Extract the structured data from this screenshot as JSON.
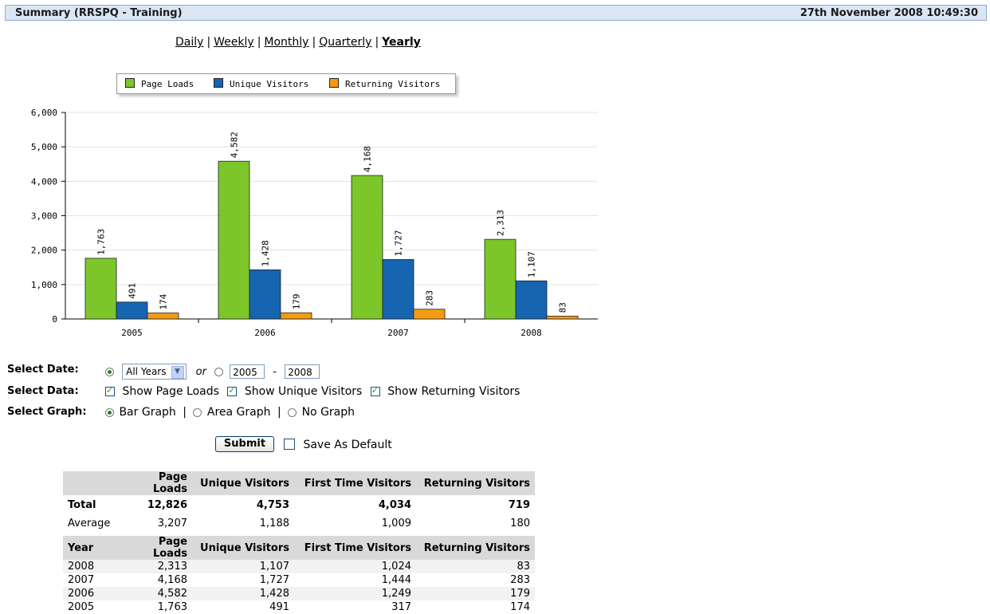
{
  "header": {
    "title": "Summary (RRSPQ - Training)",
    "datetime": "27th November 2008 10:49:30"
  },
  "period_nav": {
    "daily": "Daily",
    "weekly": "Weekly",
    "monthly": "Monthly",
    "quarterly": "Quarterly",
    "yearly": "Yearly",
    "separator": "|",
    "selected": "Yearly"
  },
  "legend": {
    "page_loads": "Page Loads",
    "unique_visitors": "Unique Visitors",
    "returning_visitors": "Returning Visitors"
  },
  "colors": {
    "page_loads": "#7cc62a",
    "unique_visitors": "#1565b0",
    "returning_visitors": "#f39c12",
    "header_bg": "#dbe6f5"
  },
  "chart_data": {
    "type": "bar",
    "categories": [
      "2005",
      "2006",
      "2007",
      "2008"
    ],
    "series": [
      {
        "name": "Page Loads",
        "values": [
          1763,
          4582,
          4168,
          2313
        ]
      },
      {
        "name": "Unique Visitors",
        "values": [
          491,
          1428,
          1727,
          1107
        ]
      },
      {
        "name": "Returning Visitors",
        "values": [
          174,
          179,
          283,
          83
        ]
      }
    ],
    "data_labels": [
      [
        "1,763",
        "4,582",
        "4,168",
        "2,313"
      ],
      [
        "491",
        "1,428",
        "1,727",
        "1,107"
      ],
      [
        "174",
        "179",
        "283",
        "83"
      ]
    ],
    "yticks": [
      "0",
      "1,000",
      "2,000",
      "3,000",
      "4,000",
      "5,000",
      "6,000"
    ],
    "ylim": [
      0,
      6000
    ],
    "grid": true,
    "legend_position": "top"
  },
  "form": {
    "select_date_label": "Select Date:",
    "date_dropdown": "All Years",
    "or_label": "or",
    "from_year": "2005",
    "dash": "-",
    "to_year": "2008",
    "select_data_label": "Select Data:",
    "show_page_loads": "Show Page Loads",
    "show_unique_visitors": "Show Unique Visitors",
    "show_returning_visitors": "Show Returning Visitors",
    "select_graph_label": "Select Graph:",
    "bar_graph": "Bar Graph",
    "area_graph": "Area Graph",
    "no_graph": "No Graph",
    "pipe": "|",
    "submit": "Submit",
    "save_default": "Save As Default"
  },
  "summary_table": {
    "headers": [
      "",
      "Page Loads",
      "Unique Visitors",
      "First Time Visitors",
      "Returning Visitors"
    ],
    "rows": [
      [
        "Total",
        "12,826",
        "4,753",
        "4,034",
        "719"
      ],
      [
        "Average",
        "3,207",
        "1,188",
        "1,009",
        "180"
      ]
    ]
  },
  "year_table": {
    "headers": [
      "Year",
      "Page Loads",
      "Unique Visitors",
      "First Time Visitors",
      "Returning Visitors"
    ],
    "rows": [
      [
        "2008",
        "2,313",
        "1,107",
        "1,024",
        "83"
      ],
      [
        "2007",
        "4,168",
        "1,727",
        "1,444",
        "283"
      ],
      [
        "2006",
        "4,582",
        "1,428",
        "1,249",
        "179"
      ],
      [
        "2005",
        "1,763",
        "491",
        "317",
        "174"
      ]
    ]
  }
}
